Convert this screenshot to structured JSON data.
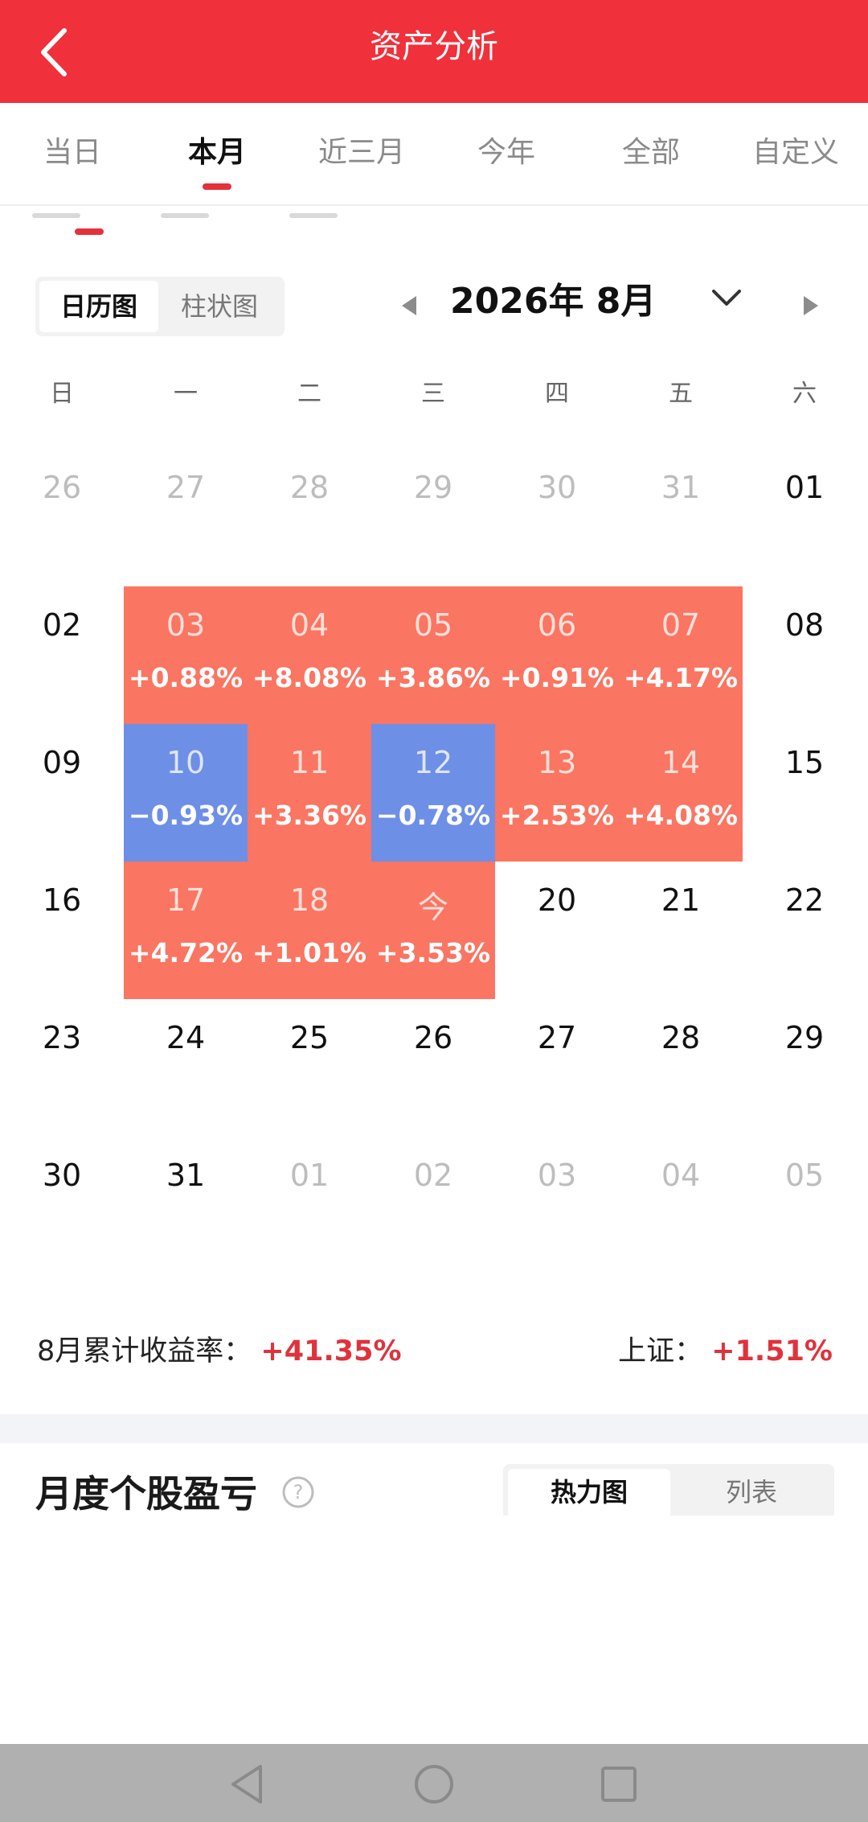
{
  "header": {
    "title": "资产分析",
    "back_icon": "chevron-left-icon"
  },
  "tabs": [
    {
      "label": "当日",
      "active": false
    },
    {
      "label": "本月",
      "active": true
    },
    {
      "label": "近三月",
      "active": false
    },
    {
      "label": "今年",
      "active": false
    },
    {
      "label": "全部",
      "active": false
    },
    {
      "label": "自定义",
      "active": false
    }
  ],
  "view_toggle": {
    "options": [
      "日历图",
      "柱状图"
    ],
    "selected": "日历图"
  },
  "month_selector": {
    "label": "2026年 8月"
  },
  "weekdays": [
    "日",
    "一",
    "二",
    "三",
    "四",
    "五",
    "六"
  ],
  "calendar": [
    [
      {
        "d": "26",
        "dim": true
      },
      {
        "d": "27",
        "dim": true
      },
      {
        "d": "28",
        "dim": true
      },
      {
        "d": "29",
        "dim": true
      },
      {
        "d": "30",
        "dim": true
      },
      {
        "d": "31",
        "dim": true
      },
      {
        "d": "01"
      }
    ],
    [
      {
        "d": "02"
      },
      {
        "d": "03",
        "p": "+0.88%",
        "t": "up"
      },
      {
        "d": "04",
        "p": "+8.08%",
        "t": "up"
      },
      {
        "d": "05",
        "p": "+3.86%",
        "t": "up"
      },
      {
        "d": "06",
        "p": "+0.91%",
        "t": "up"
      },
      {
        "d": "07",
        "p": "+4.17%",
        "t": "up"
      },
      {
        "d": "08"
      }
    ],
    [
      {
        "d": "09"
      },
      {
        "d": "10",
        "p": "−0.93%",
        "t": "down"
      },
      {
        "d": "11",
        "p": "+3.36%",
        "t": "up"
      },
      {
        "d": "12",
        "p": "−0.78%",
        "t": "down"
      },
      {
        "d": "13",
        "p": "+2.53%",
        "t": "up"
      },
      {
        "d": "14",
        "p": "+4.08%",
        "t": "up"
      },
      {
        "d": "15"
      }
    ],
    [
      {
        "d": "16"
      },
      {
        "d": "17",
        "p": "+4.72%",
        "t": "up"
      },
      {
        "d": "18",
        "p": "+1.01%",
        "t": "up"
      },
      {
        "d": "今",
        "p": "+3.53%",
        "t": "up"
      },
      {
        "d": "20"
      },
      {
        "d": "21"
      },
      {
        "d": "22"
      }
    ],
    [
      {
        "d": "23"
      },
      {
        "d": "24"
      },
      {
        "d": "25"
      },
      {
        "d": "26"
      },
      {
        "d": "27"
      },
      {
        "d": "28"
      },
      {
        "d": "29"
      }
    ],
    [
      {
        "d": "30"
      },
      {
        "d": "31"
      },
      {
        "d": "01",
        "dim": true
      },
      {
        "d": "02",
        "dim": true
      },
      {
        "d": "03",
        "dim": true
      },
      {
        "d": "04",
        "dim": true
      },
      {
        "d": "05",
        "dim": true
      }
    ]
  ],
  "summary": {
    "cumulative_label": "8月累计收益率：",
    "cumulative_value": "+41.35%",
    "index_label": "上证：",
    "index_value": "+1.51%"
  },
  "section": {
    "title": "月度个股盈亏",
    "help_icon": "question-circle-icon"
  },
  "section_toggle": {
    "options": [
      "热力图",
      "列表"
    ],
    "selected": "热力图"
  },
  "colors": {
    "header": "#f0303a",
    "gain": "#fa7562",
    "loss": "#6e8fe6",
    "accent_red": "#e0323c"
  },
  "navbar": {
    "icons": [
      "back-triangle-icon",
      "home-circle-icon",
      "recents-square-icon"
    ]
  }
}
